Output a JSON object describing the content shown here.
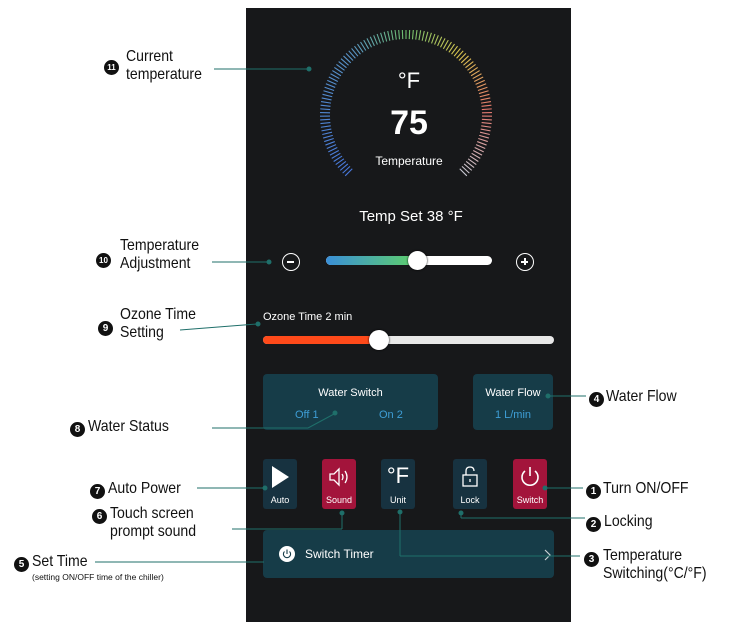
{
  "gauge": {
    "unit": "°F",
    "value": "75",
    "caption": "Temperature"
  },
  "temp_set": {
    "label": "Temp Set",
    "value": "38",
    "unit": "°F",
    "slider_level": 0.55
  },
  "ozone": {
    "label": "Ozone Time 2 min",
    "slider_level": 0.4
  },
  "water_switch": {
    "title": "Water Switch",
    "off_label": "Off 1",
    "on_label": "On 2"
  },
  "water_flow": {
    "title": "Water Flow",
    "value": "1 L/min"
  },
  "buttons": {
    "auto": "Auto",
    "sound": "Sound",
    "unit_symbol": "°F",
    "unit": "Unit",
    "lock": "Lock",
    "switch": "Switch"
  },
  "timer": {
    "label": "Switch Timer"
  },
  "annotations": {
    "current_temperature": "Current temperature",
    "current_temperature_line1": "Current",
    "current_temperature_line2": "temperature",
    "temp_adjust_line1": "Temperature",
    "temp_adjust_line2": "Adjustment",
    "ozone_line1": "Ozone Time",
    "ozone_line2": "Setting",
    "water_status": "Water Status",
    "auto_power": "Auto Power",
    "touch_sound_line1": "Touch screen",
    "touch_sound_line2": "prompt sound",
    "set_time": "Set Time",
    "set_time_sub": "(setting ON/OFF time of the chiller)",
    "turn_on_off": "Turn ON/OFF",
    "locking": "Locking",
    "water_flow": "Water Flow",
    "temp_switch_line1": "Temperature",
    "temp_switch_line2": "Switching(°C/°F)"
  },
  "badges": {
    "n1": "1",
    "n2": "2",
    "n3": "3",
    "n4": "4",
    "n5": "5",
    "n6": "6",
    "n7": "7",
    "n8": "8",
    "n9": "9",
    "n10": "10",
    "n11": "11"
  },
  "colors": {
    "panel_bg": "#17181a",
    "teal_panel": "#163c48",
    "accent_blue": "#3e9ed6",
    "red_button": "#a3143b",
    "ozone_fill": "#ff4a1a"
  }
}
